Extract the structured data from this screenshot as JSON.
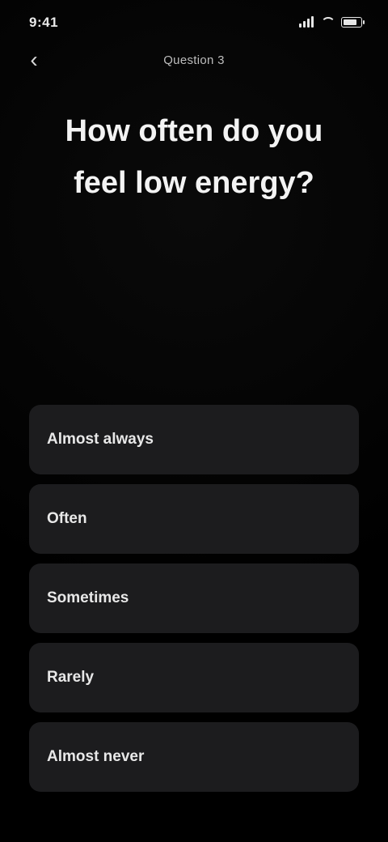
{
  "status_bar": {
    "time": "9:41",
    "icons": [
      "signal-icon",
      "wifi-icon",
      "battery-icon"
    ]
  },
  "header": {
    "back_icon": "chevron-left-icon",
    "progress": "Question 3"
  },
  "question": {
    "text": "How often do you feel low energy?"
  },
  "options": [
    {
      "label": "Almost always"
    },
    {
      "label": "Often"
    },
    {
      "label": "Sometimes"
    },
    {
      "label": "Rarely"
    },
    {
      "label": "Almost never"
    }
  ],
  "colors": {
    "background": "#000000",
    "option_background": "#1c1c1e",
    "text": "#f2f2f2"
  }
}
